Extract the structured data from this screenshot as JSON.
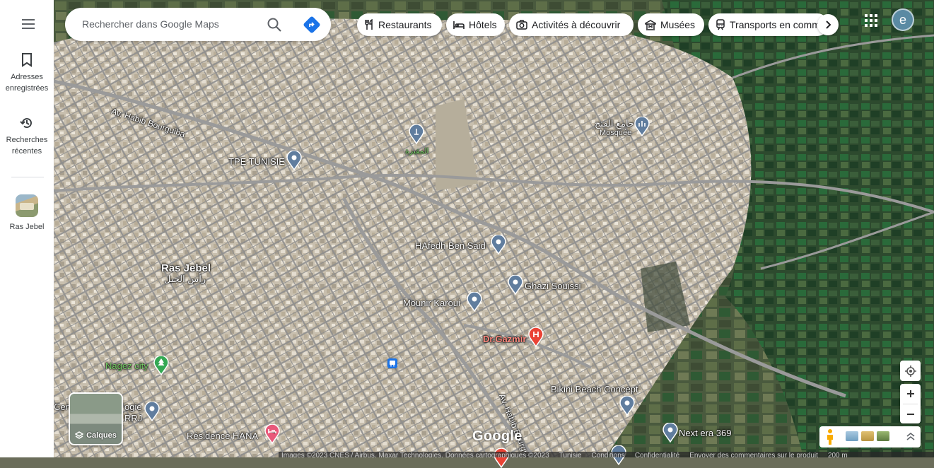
{
  "rail": {
    "saved_label": "Adresses enregistrées",
    "recent_label": "Recherches récentes",
    "recent_place_label": "Ras Jebel"
  },
  "search": {
    "placeholder": "Rechercher dans Google Maps"
  },
  "chips": [
    {
      "label": "Restaurants",
      "icon": "fork-knife-icon"
    },
    {
      "label": "Hôtels",
      "icon": "bed-icon"
    },
    {
      "label": "Activités à découvrir",
      "icon": "camera-icon"
    },
    {
      "label": "Musées",
      "icon": "museum-icon"
    },
    {
      "label": "Transports en commun",
      "icon": "train-icon"
    }
  ],
  "account": {
    "initial": "e"
  },
  "map_labels": {
    "road_habib_bourguiba_1": "Av. Habib Bourguiba",
    "road_habib_bourguiba_2": "Av. Habib Bourguiba",
    "tpe_tunisie": "TPE TUNISIE",
    "cemetery": "المقبرة",
    "mosque_ar": "جامع الفتح",
    "mosque_fr": "Mosquée",
    "hafedh": "HAfedh Ben Said",
    "ras_jebel": "Ras Jebel",
    "ras_jebel_ar": "رأس الجبل",
    "ghazi": "Ghazi Souissi",
    "mounir": "Mounir Karoui",
    "gazmir": "Dr.Gazmir",
    "nagez": "Nagez city",
    "bikini": "Bikini Beach Concept",
    "centre_1": "Cen",
    "centre_2": "ogie",
    "centre_3": "RRJ",
    "residence": "Résidence HANA",
    "next_era": "Next era 369"
  },
  "layers": {
    "label": "Calques"
  },
  "attribution": {
    "google": "Google",
    "images": "Images ©2023 CNES / Airbus, Maxar Technologies, Données cartographiques ©2023",
    "country": "Tunisie",
    "conditions": "Conditions",
    "privacy": "Confidentialité",
    "feedback": "Envoyer des commentaires sur le produit",
    "scale": "200 m"
  },
  "colors": {
    "accent": "#1a73e8",
    "avatar": "#5a8aa3",
    "hospital": "#ea4335",
    "hotel": "#e8587a",
    "park": "#34a853",
    "pin_default": "#607d9e"
  }
}
